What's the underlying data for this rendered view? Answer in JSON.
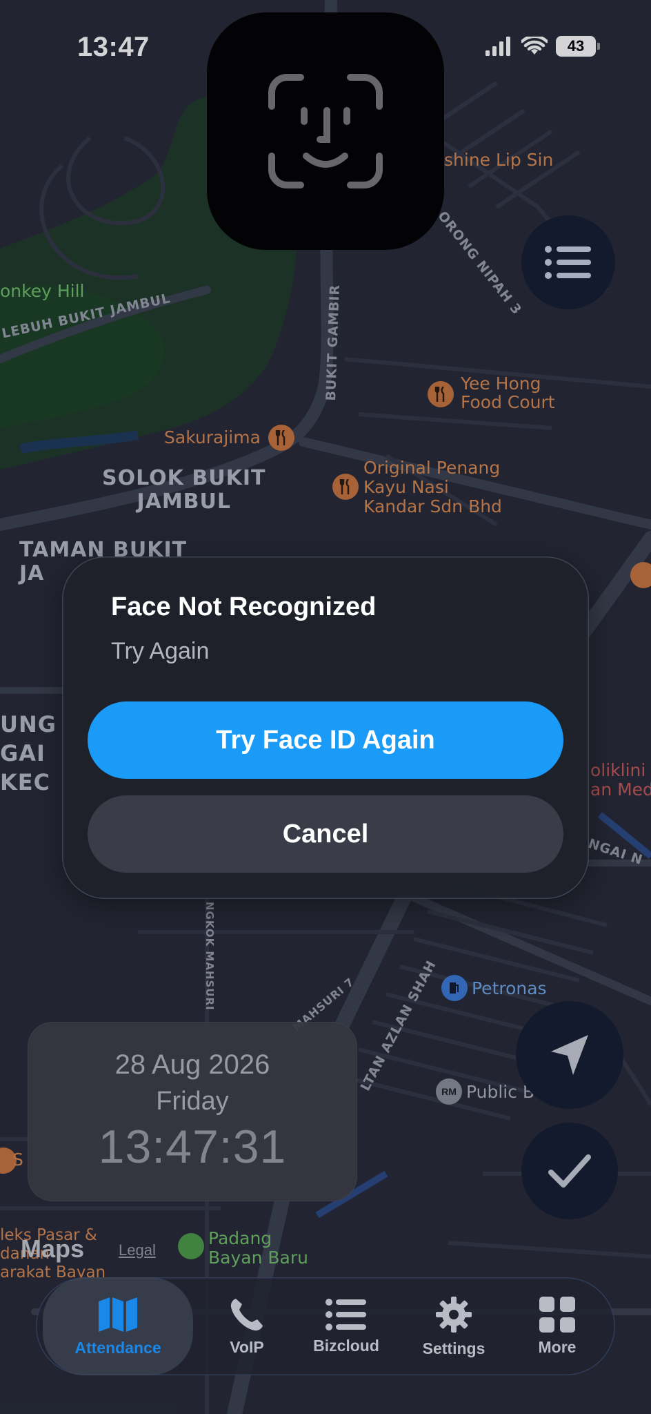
{
  "status_bar": {
    "time": "13:47",
    "battery": "43"
  },
  "map": {
    "labels": {
      "monkey_hill": "onkey Hill",
      "lebuh_bukit_jambul": "LEBUH BUKIT JAMBUL",
      "lip_sin": "shine Lip Sin",
      "orong_nipah": "ORONG NIPAH 3",
      "bukit_gambir": "BUKIT GAMBIR",
      "yee_hong": "Yee Hong\nFood Court",
      "sakurajima": "Sakurajima",
      "original_penang": "Original Penang\nKayu Nasi\nKandar Sdn Bhd",
      "solok_bukit_jambul": "SOLOK BUKIT\nJAMBUL",
      "taman_bukit": "TAMAN BUKIT\nJA",
      "sungai_kec": "UNG\nGAI\nKEC",
      "poliklinik": "oliklini\nan Med",
      "sungai_road": "NGAI N",
      "ngkok_mahsuri": "NGKOK MAHSURI",
      "mahsuri_7": "MAHSURI 7",
      "sultan_azlan_shah": "LTAN AZLAN SHAH",
      "petronas": "Petronas",
      "public_bank": "Public B",
      "padang": "Padang\nBayan Baru",
      "kompleks": "leks Pasar &\ndanan\narakat Bayan",
      "s_left": "S"
    },
    "maps_brand": "Maps",
    "legal": "Legal"
  },
  "face_id": {
    "icon": "face-id-icon"
  },
  "dialog": {
    "title": "Face Not Recognized",
    "subtitle": "Try Again",
    "primary_button": "Try Face ID Again",
    "secondary_button": "Cancel"
  },
  "date_card": {
    "date": "28 Aug 2026",
    "day": "Friday",
    "time": "13:47:31"
  },
  "tabbar": {
    "tabs": [
      {
        "label": "Attendance",
        "icon": "map-icon",
        "active": true
      },
      {
        "label": "VoIP",
        "icon": "phone-icon",
        "active": false
      },
      {
        "label": "Bizcloud",
        "icon": "list-icon",
        "active": false
      },
      {
        "label": "Settings",
        "icon": "gear-icon",
        "active": false
      },
      {
        "label": "More",
        "icon": "grid-icon",
        "active": false
      }
    ]
  },
  "colors": {
    "accent": "#1a9bf8",
    "tab_active": "#1a88e8",
    "map_bg": "#262a36"
  }
}
